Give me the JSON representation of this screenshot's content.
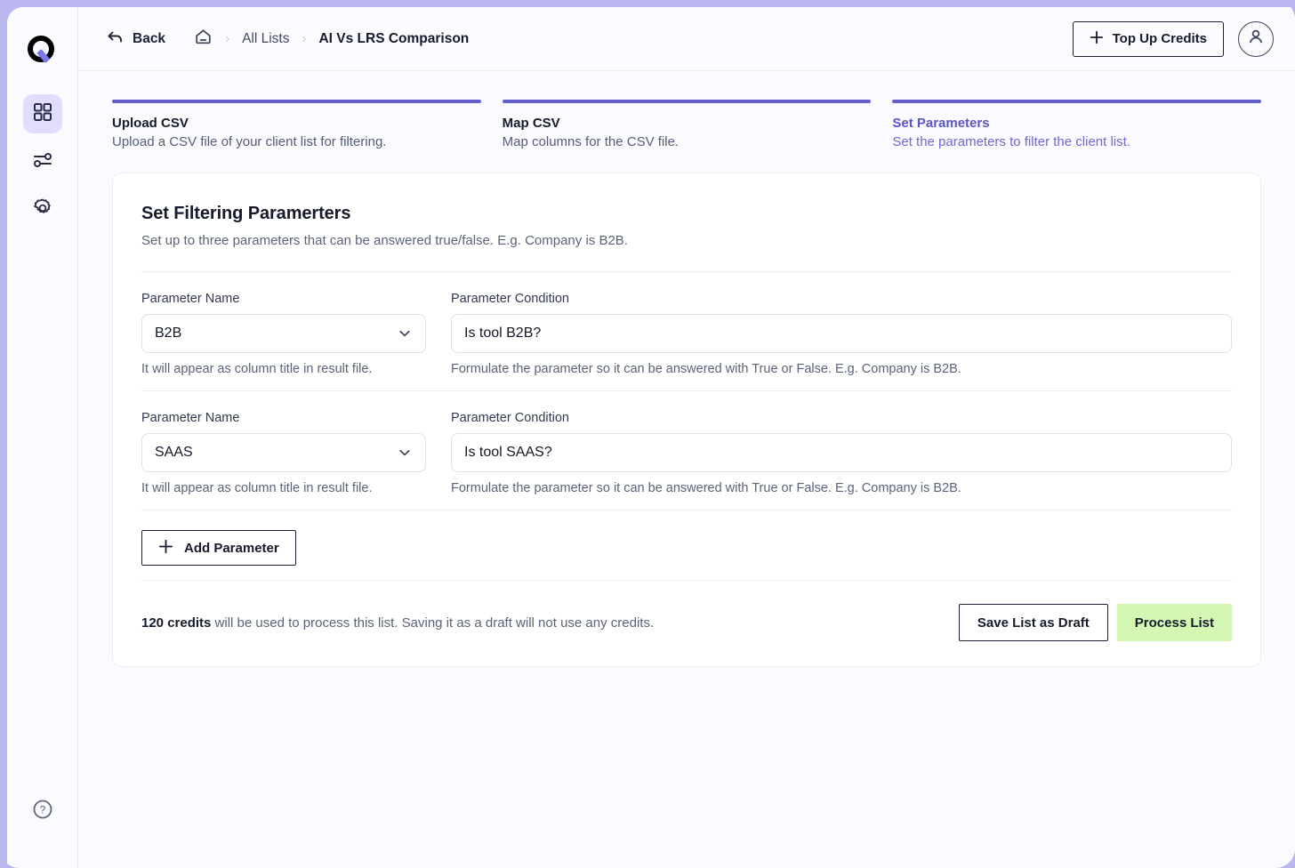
{
  "topbar": {
    "back_label": "Back",
    "breadcrumbs": [
      {
        "label": "All Lists",
        "current": false
      },
      {
        "label": "AI Vs LRS Comparison",
        "current": true
      }
    ],
    "separator": "›",
    "topup_label": "Top Up Credits"
  },
  "sidebar": {
    "items": [
      {
        "name": "dashboard",
        "active": true
      },
      {
        "name": "filters",
        "active": false
      },
      {
        "name": "settings",
        "active": false
      }
    ],
    "help": "?"
  },
  "steps": [
    {
      "title": "Upload CSV",
      "desc": "Upload a CSV file of your client list for filtering.",
      "active": false
    },
    {
      "title": "Map CSV",
      "desc": "Map columns for the CSV file.",
      "active": false
    },
    {
      "title": "Set Parameters",
      "desc": "Set the parameters to filter the client list.",
      "active": true
    }
  ],
  "card": {
    "title": "Set Filtering Paramerters",
    "subtitle": "Set up to three parameters that can be answered true/false. E.g. Company is B2B.",
    "labels": {
      "param_name": "Parameter Name",
      "param_condition": "Parameter Condition",
      "name_hint": "It will appear as column title in result file.",
      "condition_hint": "Formulate the parameter so it can be answered with True or False. E.g. Company is B2B."
    },
    "parameters": [
      {
        "name": "B2B",
        "condition": "Is tool B2B?"
      },
      {
        "name": "SAAS",
        "condition": "Is tool SAAS?"
      }
    ],
    "add_parameter_label": "Add Parameter"
  },
  "footer": {
    "credits_amount": "120 credits",
    "credits_text": " will be used to process this list. Saving it as a draft will not use any credits.",
    "save_draft_label": "Save List as Draft",
    "process_label": "Process List"
  },
  "colors": {
    "accent": "#6360cb",
    "frame": "#b9b6f0",
    "process_green": "#d2f8b4",
    "active_step_text": "#5b57c4"
  }
}
